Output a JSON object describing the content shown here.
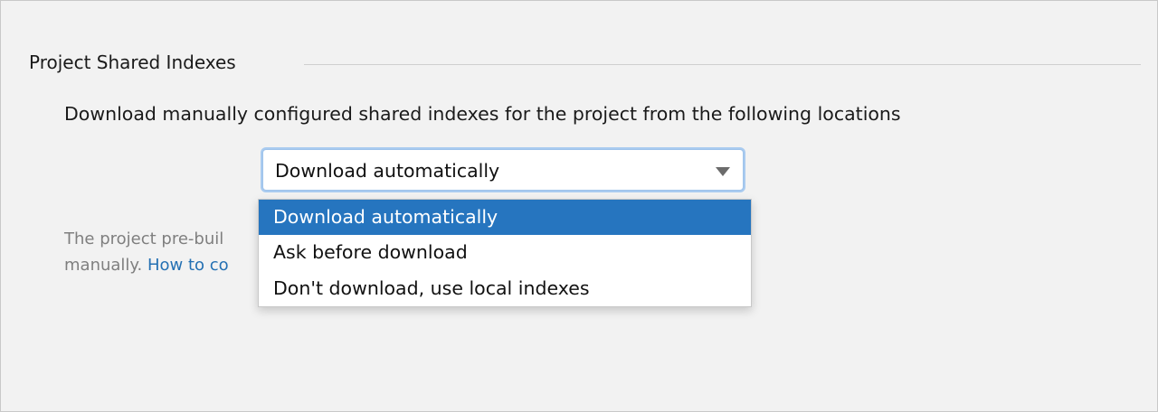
{
  "section": {
    "title": "Project Shared Indexes"
  },
  "description": "Download manually configured shared indexes for the project from the following locations",
  "combo": {
    "selected": "Download automatically",
    "options": [
      "Download automatically",
      "Ask before download",
      "Don't download, use local indexes"
    ],
    "highlighted_index": 0
  },
  "hint": {
    "line1": "The project pre-buil",
    "line2_prefix": "manually. ",
    "link": "How to co"
  },
  "colors": {
    "selection": "#2675bf",
    "link": "#2470b3",
    "focus_ring": "#a9cbf0"
  }
}
